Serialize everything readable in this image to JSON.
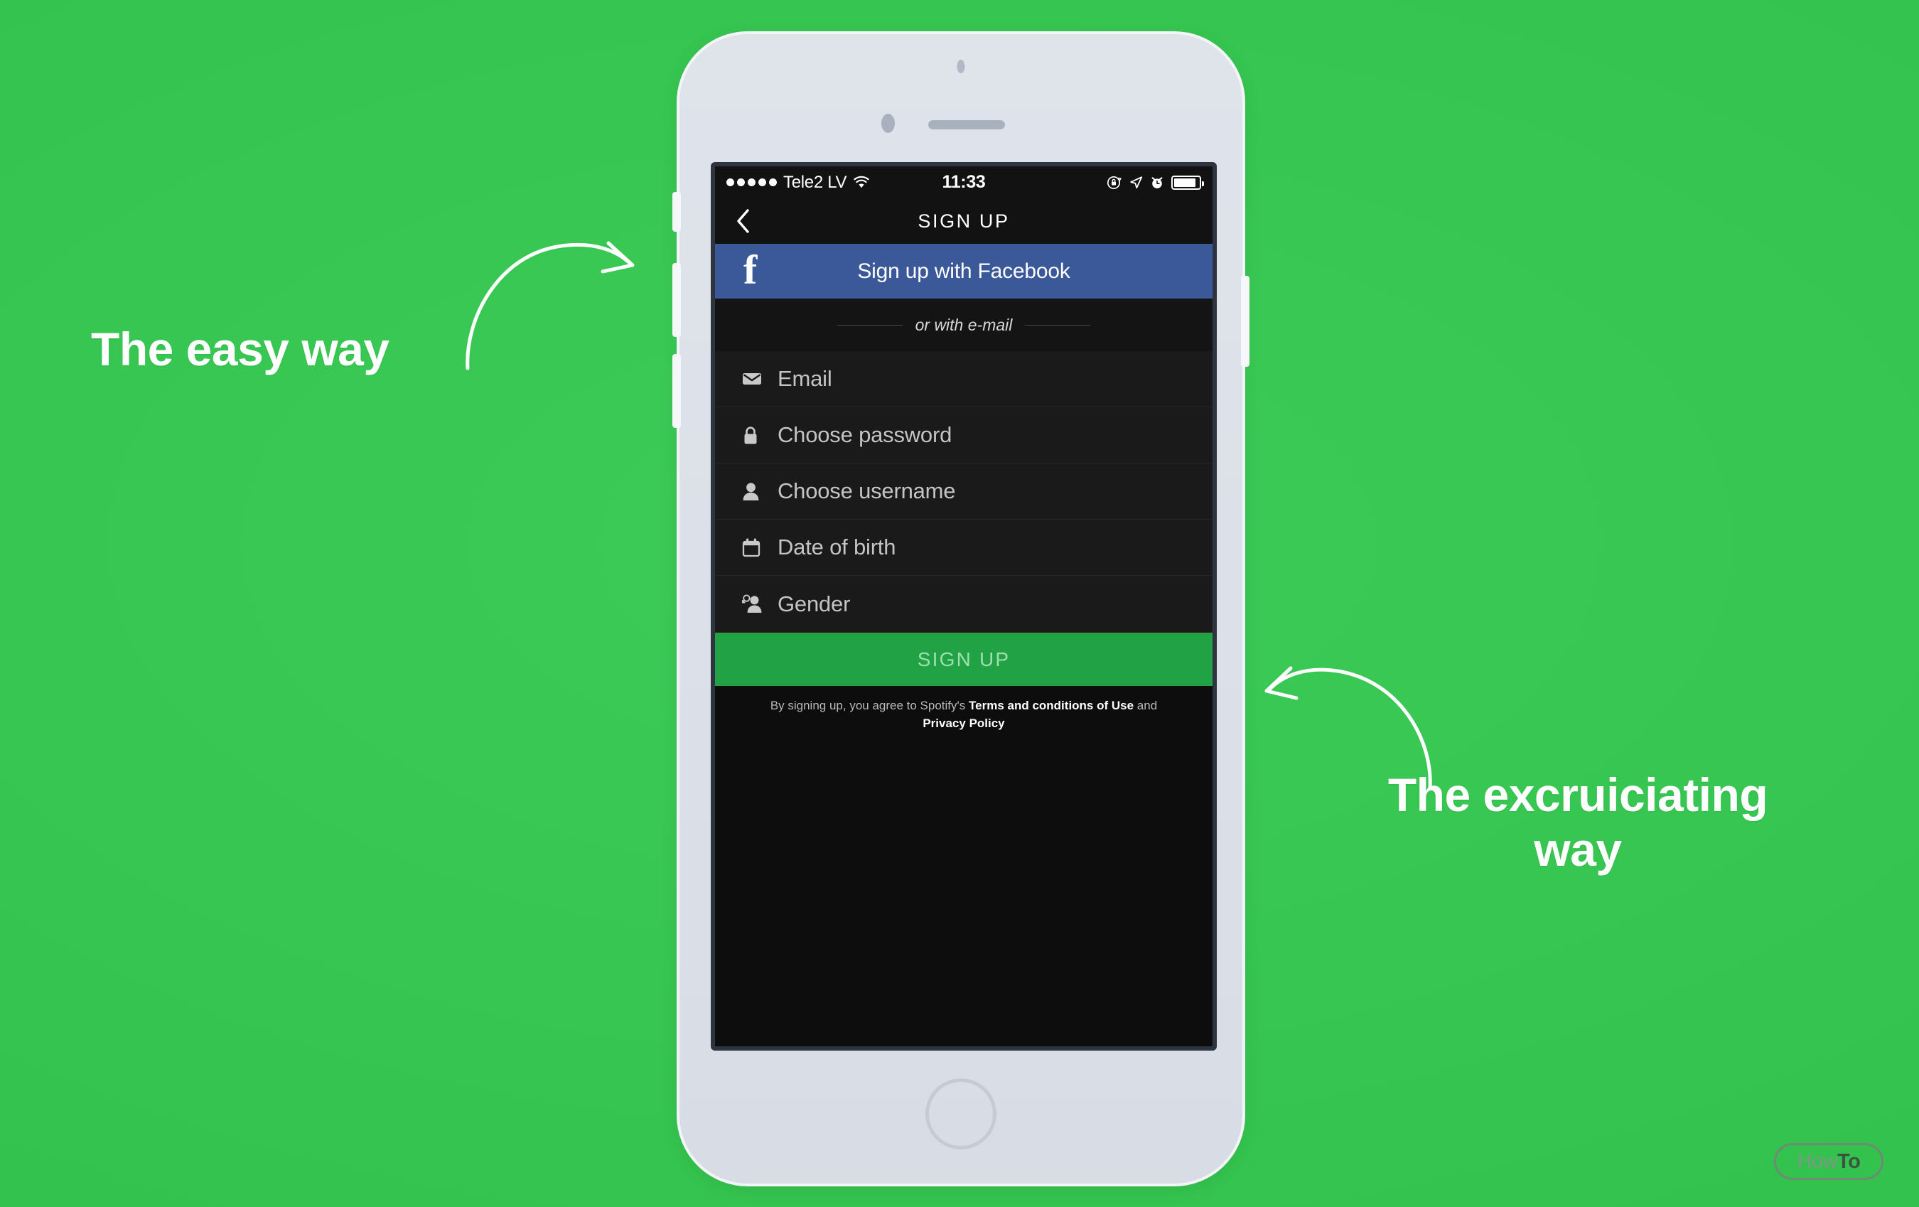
{
  "background": {
    "color": "#34c34e"
  },
  "annotations": {
    "left": {
      "text": "The easy way",
      "arrow": "curved-arrow-up-right"
    },
    "right": {
      "line1": "The excruiciating",
      "line2": "way",
      "arrow": "curved-arrow-up-left"
    }
  },
  "watermark": {
    "part1": "How",
    "part2": "To"
  },
  "phone": {
    "hardware": {
      "sensor": "proximity-sensor",
      "camera": "front-camera",
      "earpiece": "earpiece-speaker",
      "home_button": "home-button",
      "buttons": [
        "silent-switch",
        "volume-up",
        "volume-down",
        "power"
      ]
    },
    "screen": {
      "status_bar": {
        "signal_dots": 5,
        "carrier": "Tele2 LV",
        "wifi": "wifi-icon",
        "time": "11:33",
        "icons": [
          "rotation-lock-icon",
          "location-arrow-icon",
          "alarm-clock-icon",
          "battery-icon"
        ],
        "battery_level": "88%"
      },
      "nav_bar": {
        "back": "back-chevron-icon",
        "title": "SIGN UP"
      },
      "facebook_button": {
        "logo": "facebook-f-icon",
        "label": "Sign up with Facebook",
        "color": "#3b5998"
      },
      "divider": {
        "label": "or with e-mail"
      },
      "fields": [
        {
          "icon": "envelope-icon",
          "label": "Email"
        },
        {
          "icon": "lock-icon",
          "label": "Choose password"
        },
        {
          "icon": "person-icon",
          "label": "Choose username"
        },
        {
          "icon": "calendar-icon",
          "label": "Date of birth"
        },
        {
          "icon": "gender-icon",
          "label": "Gender"
        }
      ],
      "signup_button": {
        "label": "SIGN UP",
        "color": "#21a245",
        "text_color": "#9ddfae"
      },
      "terms": {
        "prefix": "By signing up, you agree to Spotify's ",
        "link1": "Terms and conditions of Use",
        "middle": " and ",
        "link2": "Privacy Policy"
      }
    }
  }
}
